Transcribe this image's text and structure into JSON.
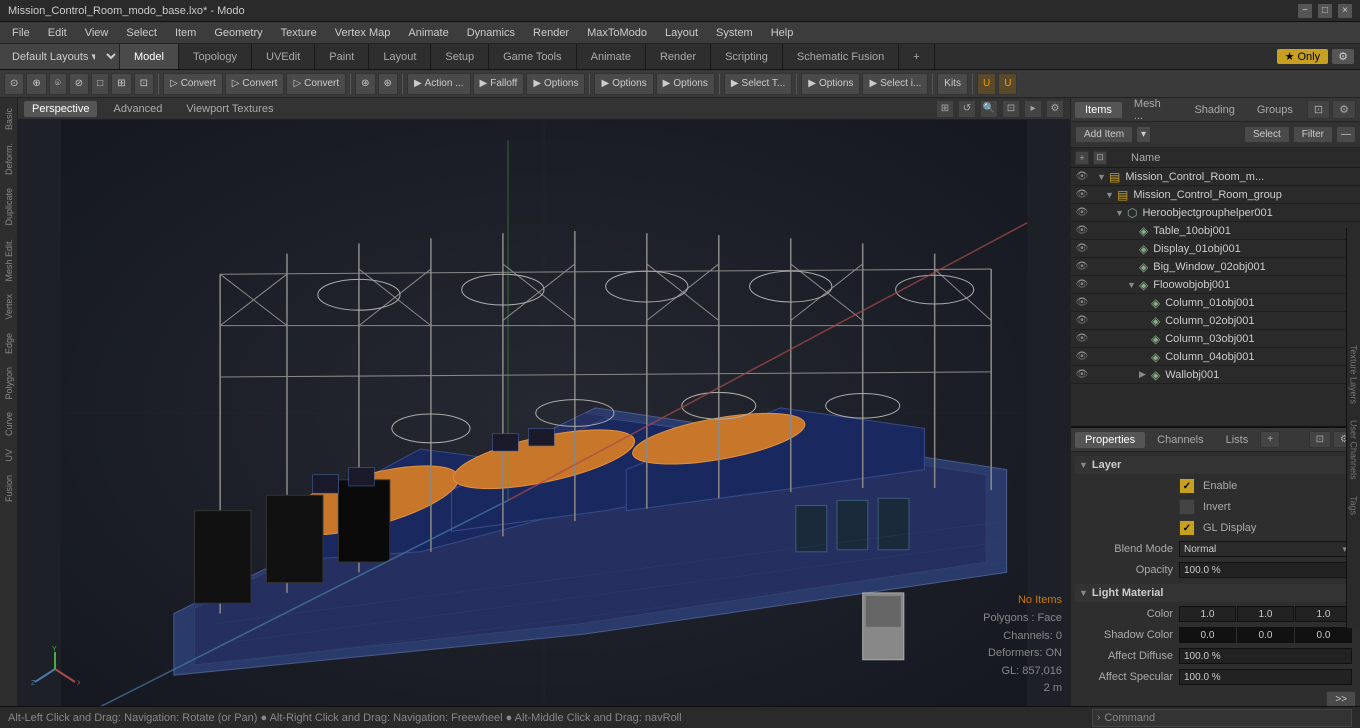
{
  "titlebar": {
    "title": "Mission_Control_Room_modo_base.lxo* - Modo",
    "controls": [
      "−",
      "□",
      "×"
    ]
  },
  "menubar": {
    "items": [
      "File",
      "Edit",
      "View",
      "Select",
      "Item",
      "Geometry",
      "Texture",
      "Vertex Map",
      "Animate",
      "Dynamics",
      "Render",
      "MaxToModo",
      "Layout",
      "System",
      "Help"
    ]
  },
  "tabs": {
    "layout_select": "Default Layouts",
    "items": [
      "Model",
      "Topology",
      "UVEdit",
      "Paint",
      "Layout",
      "Setup",
      "Game Tools",
      "Animate",
      "Render",
      "Scripting",
      "Schematic Fusion"
    ],
    "active": "Model",
    "only_label": "★ Only",
    "plus_label": "+"
  },
  "toolbar": {
    "groups": [
      {
        "items": [
          "⊙",
          "⊕",
          "⌾",
          "⊘",
          "⊟",
          "⊞",
          "⊡"
        ]
      },
      {
        "items": [
          {
            "label": "Convert",
            "icon": "▷"
          },
          {
            "label": "Convert",
            "icon": "▷"
          },
          {
            "label": "Convert",
            "icon": "▷"
          }
        ]
      },
      {
        "items": [
          {
            "label": "",
            "icon": "⊛"
          },
          {
            "label": "",
            "icon": "⊛"
          }
        ]
      },
      {
        "items": [
          {
            "label": "Action ...",
            "icon": "▶"
          },
          {
            "label": "Falloff",
            "icon": "▶"
          },
          {
            "label": "Options",
            "icon": "▶"
          }
        ]
      },
      {
        "items": [
          {
            "label": "Options",
            "icon": "▶"
          },
          {
            "label": "Options",
            "icon": "▶"
          }
        ]
      },
      {
        "items": [
          {
            "label": "Select T...",
            "icon": "▶"
          }
        ]
      },
      {
        "items": [
          {
            "label": "Options",
            "icon": "▶"
          },
          {
            "label": "Select i...",
            "icon": "▶"
          }
        ]
      },
      {
        "items": [
          {
            "label": "Kits",
            "icon": ""
          }
        ]
      },
      {
        "items": [
          {
            "label": "",
            "icon": "⊞"
          },
          {
            "label": "",
            "icon": "⊟"
          }
        ]
      }
    ]
  },
  "viewport": {
    "tabs": [
      "Perspective",
      "Advanced",
      "Viewport Textures"
    ],
    "active_tab": "Perspective",
    "info": {
      "no_items": "No Items",
      "polygons": "Polygons : Face",
      "channels": "Channels: 0",
      "deformers": "Deformers: ON",
      "gl": "GL: 857,016",
      "distance": "2 m"
    }
  },
  "left_sidebar": {
    "items": [
      "Basic",
      "Deform.",
      "Duplicate",
      "Mesh Edit.",
      "Vertex",
      "Edge",
      "Polygon",
      "Curve",
      "UV",
      "Fusion"
    ]
  },
  "right_panel": {
    "top_tabs": [
      "Items",
      "Mesh ...",
      "Shading",
      "Groups"
    ],
    "active_top_tab": "Items",
    "toolbar": {
      "add_item_label": "Add Item",
      "select_label": "Select",
      "filter_label": "Filter"
    },
    "col_header": "Name",
    "items_tree": [
      {
        "id": 1,
        "name": "Mission_Control_Room_m...",
        "indent": 0,
        "type": "group",
        "expanded": true,
        "eye": true
      },
      {
        "id": 2,
        "name": "Mission_Control_Room_group",
        "indent": 1,
        "type": "group",
        "expanded": true,
        "eye": true
      },
      {
        "id": 3,
        "name": "Heroobjectgrouphelper001",
        "indent": 2,
        "type": "group",
        "expanded": true,
        "eye": true
      },
      {
        "id": 4,
        "name": "Table_10obj001",
        "indent": 3,
        "type": "mesh",
        "expanded": false,
        "eye": true
      },
      {
        "id": 5,
        "name": "Display_01obj001",
        "indent": 3,
        "type": "mesh",
        "expanded": false,
        "eye": true
      },
      {
        "id": 6,
        "name": "Big_Window_02obj001",
        "indent": 3,
        "type": "mesh",
        "expanded": false,
        "eye": true
      },
      {
        "id": 7,
        "name": "Floowobjobj001",
        "indent": 3,
        "type": "mesh",
        "expanded": true,
        "eye": true
      },
      {
        "id": 8,
        "name": "Column_01obj001",
        "indent": 4,
        "type": "mesh",
        "expanded": false,
        "eye": true
      },
      {
        "id": 9,
        "name": "Column_02obj001",
        "indent": 4,
        "type": "mesh",
        "expanded": false,
        "eye": true
      },
      {
        "id": 10,
        "name": "Column_03obj001",
        "indent": 4,
        "type": "mesh",
        "expanded": false,
        "eye": true
      },
      {
        "id": 11,
        "name": "Column_04obj001",
        "indent": 4,
        "type": "mesh",
        "expanded": false,
        "eye": true
      },
      {
        "id": 12,
        "name": "Wallobj001",
        "indent": 4,
        "type": "mesh",
        "expanded": true,
        "eye": true
      }
    ]
  },
  "properties": {
    "tabs": [
      "Properties",
      "Channels",
      "Lists"
    ],
    "active_tab": "Properties",
    "sections": [
      {
        "name": "Layer",
        "rows": [
          {
            "type": "checkbox",
            "label": "Enable",
            "checked": true
          },
          {
            "type": "checkbox_plain",
            "label": "Invert",
            "checked": false
          },
          {
            "type": "checkbox",
            "label": "GL Display",
            "checked": true
          }
        ]
      },
      {
        "name": "blend_mode",
        "label_text": "Blend Mode",
        "type": "dropdown",
        "value": "Normal"
      },
      {
        "name": "opacity",
        "label_text": "Opacity",
        "type": "value",
        "value": "100.0 %"
      },
      {
        "name": "light_material",
        "label": "Light Material",
        "rows": [
          {
            "type": "color",
            "label": "Color",
            "r": "1.0",
            "g": "1.0",
            "b": "1.0"
          },
          {
            "type": "color",
            "label": "Shadow Color",
            "r": "0.0",
            "g": "0.0",
            "b": "0.0"
          },
          {
            "type": "value",
            "label": "Affect Diffuse",
            "value": "100.0 %"
          },
          {
            "type": "value",
            "label": "Affect Specular",
            "value": "100.0 %"
          }
        ]
      }
    ]
  },
  "right_side_tabs": [
    "Texture Layers",
    "User Channels",
    "Tags"
  ],
  "statusbar": {
    "message": "Alt-Left Click and Drag: Navigation: Rotate (or Pan)  ● Alt-Right Click and Drag: Navigation: Freewheel  ●  Alt-Middle Click and Drag: navRoll",
    "command_label": "Command",
    "expand_icon": "›"
  }
}
